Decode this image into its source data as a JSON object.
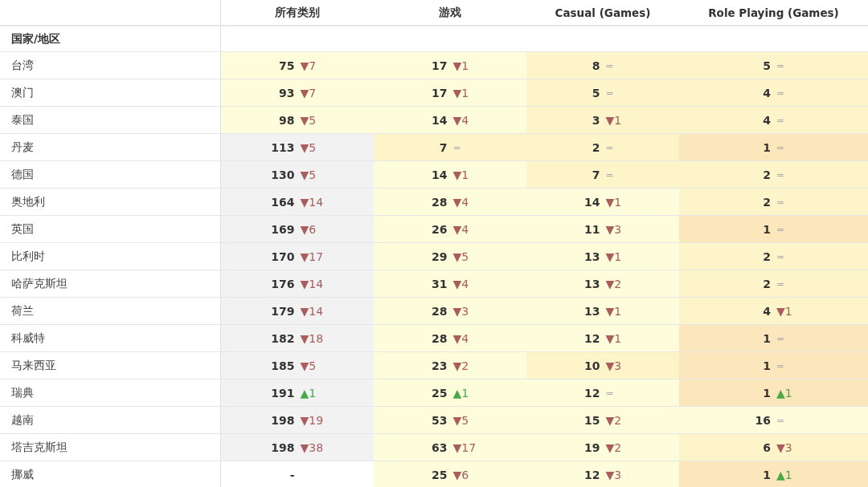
{
  "columns": [
    "所有类别",
    "游戏",
    "Casual (Games)",
    "Role Playing (Games)"
  ],
  "row_header": "国家/地区",
  "rows": [
    {
      "name": "台湾",
      "cells": [
        {
          "value": "75",
          "delta": "▼7",
          "kind": "down",
          "color": "#fefddb"
        },
        {
          "value": "17",
          "delta": "▼1",
          "kind": "down",
          "color": "#fefddb"
        },
        {
          "value": "8",
          "delta": "=",
          "kind": "same",
          "color": "#fdf5c9"
        },
        {
          "value": "5",
          "delta": "=",
          "kind": "same",
          "color": "#fdf5c9"
        }
      ]
    },
    {
      "name": "澳门",
      "cells": [
        {
          "value": "93",
          "delta": "▼7",
          "kind": "down",
          "color": "#fefddb"
        },
        {
          "value": "17",
          "delta": "▼1",
          "kind": "down",
          "color": "#fefddb"
        },
        {
          "value": "5",
          "delta": "=",
          "kind": "same",
          "color": "#fdf5c9"
        },
        {
          "value": "4",
          "delta": "=",
          "kind": "same",
          "color": "#fdf5c9"
        }
      ]
    },
    {
      "name": "泰国",
      "cells": [
        {
          "value": "98",
          "delta": "▼5",
          "kind": "down",
          "color": "#fefddb"
        },
        {
          "value": "14",
          "delta": "▼4",
          "kind": "down",
          "color": "#fefddb"
        },
        {
          "value": "3",
          "delta": "▼1",
          "kind": "down",
          "color": "#fdf5c9"
        },
        {
          "value": "4",
          "delta": "=",
          "kind": "same",
          "color": "#fdf5c9"
        }
      ]
    },
    {
      "name": "丹麦",
      "cells": [
        {
          "value": "113",
          "delta": "▼5",
          "kind": "down",
          "color": "#f2f2f2"
        },
        {
          "value": "7",
          "delta": "=",
          "kind": "same",
          "color": "#fdf5c9"
        },
        {
          "value": "2",
          "delta": "=",
          "kind": "same",
          "color": "#fdf5c9"
        },
        {
          "value": "1",
          "delta": "=",
          "kind": "same",
          "color": "#fce6bc"
        }
      ]
    },
    {
      "name": "德国",
      "cells": [
        {
          "value": "130",
          "delta": "▼5",
          "kind": "down",
          "color": "#f2f2f2"
        },
        {
          "value": "14",
          "delta": "▼1",
          "kind": "down",
          "color": "#fefddb"
        },
        {
          "value": "7",
          "delta": "=",
          "kind": "same",
          "color": "#fdf5c9"
        },
        {
          "value": "2",
          "delta": "=",
          "kind": "same",
          "color": "#fdf5c9"
        }
      ]
    },
    {
      "name": "奥地利",
      "cells": [
        {
          "value": "164",
          "delta": "▼14",
          "kind": "down",
          "color": "#f2f2f2"
        },
        {
          "value": "28",
          "delta": "▼4",
          "kind": "down",
          "color": "#fefddb"
        },
        {
          "value": "14",
          "delta": "▼1",
          "kind": "down",
          "color": "#fefddb"
        },
        {
          "value": "2",
          "delta": "=",
          "kind": "same",
          "color": "#fdf5c9"
        }
      ]
    },
    {
      "name": "英国",
      "cells": [
        {
          "value": "169",
          "delta": "▼6",
          "kind": "down",
          "color": "#f2f2f2"
        },
        {
          "value": "26",
          "delta": "▼4",
          "kind": "down",
          "color": "#fefddb"
        },
        {
          "value": "11",
          "delta": "▼3",
          "kind": "down",
          "color": "#fefddb"
        },
        {
          "value": "1",
          "delta": "=",
          "kind": "same",
          "color": "#fce6bc"
        }
      ]
    },
    {
      "name": "比利时",
      "cells": [
        {
          "value": "170",
          "delta": "▼17",
          "kind": "down",
          "color": "#f2f2f2"
        },
        {
          "value": "29",
          "delta": "▼5",
          "kind": "down",
          "color": "#fefddb"
        },
        {
          "value": "13",
          "delta": "▼1",
          "kind": "down",
          "color": "#fefddb"
        },
        {
          "value": "2",
          "delta": "=",
          "kind": "same",
          "color": "#fdf5c9"
        }
      ]
    },
    {
      "name": "哈萨克斯坦",
      "cells": [
        {
          "value": "176",
          "delta": "▼14",
          "kind": "down",
          "color": "#f2f2f2"
        },
        {
          "value": "31",
          "delta": "▼4",
          "kind": "down",
          "color": "#fefddb"
        },
        {
          "value": "13",
          "delta": "▼2",
          "kind": "down",
          "color": "#fefddb"
        },
        {
          "value": "2",
          "delta": "=",
          "kind": "same",
          "color": "#fdf5c9"
        }
      ]
    },
    {
      "name": "荷兰",
      "cells": [
        {
          "value": "179",
          "delta": "▼14",
          "kind": "down",
          "color": "#f2f2f2"
        },
        {
          "value": "28",
          "delta": "▼3",
          "kind": "down",
          "color": "#fefddb"
        },
        {
          "value": "13",
          "delta": "▼1",
          "kind": "down",
          "color": "#fefddb"
        },
        {
          "value": "4",
          "delta": "▼1",
          "kind": "down",
          "color": "#fdf5c9"
        }
      ]
    },
    {
      "name": "科威特",
      "cells": [
        {
          "value": "182",
          "delta": "▼18",
          "kind": "down",
          "color": "#f2f2f2"
        },
        {
          "value": "28",
          "delta": "▼4",
          "kind": "down",
          "color": "#fefddb"
        },
        {
          "value": "12",
          "delta": "▼1",
          "kind": "down",
          "color": "#fefddb"
        },
        {
          "value": "1",
          "delta": "=",
          "kind": "same",
          "color": "#fce6bc"
        }
      ]
    },
    {
      "name": "马来西亚",
      "cells": [
        {
          "value": "185",
          "delta": "▼5",
          "kind": "down",
          "color": "#f2f2f2"
        },
        {
          "value": "23",
          "delta": "▼2",
          "kind": "down",
          "color": "#fefddb"
        },
        {
          "value": "10",
          "delta": "▼3",
          "kind": "down",
          "color": "#fdf5c9"
        },
        {
          "value": "1",
          "delta": "=",
          "kind": "same",
          "color": "#fce6bc"
        }
      ]
    },
    {
      "name": "瑞典",
      "cells": [
        {
          "value": "191",
          "delta": "▲1",
          "kind": "up",
          "color": "#f2f2f2"
        },
        {
          "value": "25",
          "delta": "▲1",
          "kind": "up",
          "color": "#fefddb"
        },
        {
          "value": "12",
          "delta": "=",
          "kind": "same",
          "color": "#fefddb"
        },
        {
          "value": "1",
          "delta": "▲1",
          "kind": "up",
          "color": "#fce6bc"
        }
      ]
    },
    {
      "name": "越南",
      "cells": [
        {
          "value": "198",
          "delta": "▼19",
          "kind": "down",
          "color": "#f2f2f2"
        },
        {
          "value": "53",
          "delta": "▼5",
          "kind": "down",
          "color": "#fefddb"
        },
        {
          "value": "15",
          "delta": "▼2",
          "kind": "down",
          "color": "#fefddb"
        },
        {
          "value": "16",
          "delta": "=",
          "kind": "same",
          "color": "#fefddb"
        }
      ]
    },
    {
      "name": "塔吉克斯坦",
      "cells": [
        {
          "value": "198",
          "delta": "▼38",
          "kind": "down",
          "color": "#f2f2f2"
        },
        {
          "value": "63",
          "delta": "▼17",
          "kind": "down",
          "color": "#fefddb"
        },
        {
          "value": "19",
          "delta": "▼2",
          "kind": "down",
          "color": "#fefddb"
        },
        {
          "value": "6",
          "delta": "▼3",
          "kind": "down",
          "color": "#fdf5c9"
        }
      ]
    },
    {
      "name": "挪威",
      "cells": [
        {
          "value": "-",
          "color": "#ffffff"
        },
        {
          "value": "25",
          "delta": "▼6",
          "kind": "down",
          "color": "#fefddb"
        },
        {
          "value": "12",
          "delta": "▼3",
          "kind": "down",
          "color": "#fefddb"
        },
        {
          "value": "1",
          "delta": "▲1",
          "kind": "up",
          "color": "#fce6bc"
        }
      ]
    }
  ]
}
